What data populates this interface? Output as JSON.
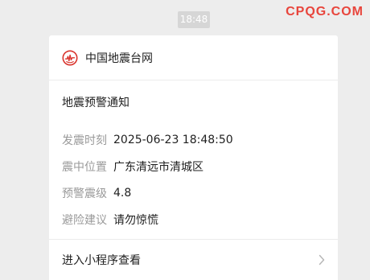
{
  "chat": {
    "timestamp": "18:48"
  },
  "watermark": {
    "text": "CPQG.COM"
  },
  "card": {
    "source_name": "中国地震台网",
    "title": "地震预警通知",
    "fields": [
      {
        "label": "发震时刻",
        "value": "2025-06-23 18:48:50"
      },
      {
        "label": "震中位置",
        "value": "广东清远市清城区"
      },
      {
        "label": "预警震级",
        "value": "4.8"
      },
      {
        "label": "避险建议",
        "value": "请勿惊慌"
      }
    ],
    "footer_label": "进入小程序查看"
  },
  "icons": {
    "logo": "china-earthquake-network-logo",
    "footer": "chevron-right-icon"
  },
  "colors": {
    "background": "#ededed",
    "card": "#ffffff",
    "label": "#9a9a9a",
    "text": "#1f1f1f",
    "brand": "#e8453c"
  }
}
